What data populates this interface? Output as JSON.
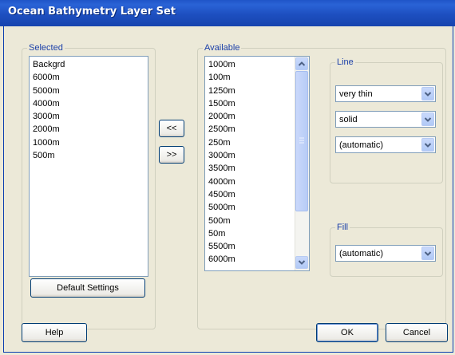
{
  "window": {
    "title": "Ocean Bathymetry Layer Set"
  },
  "selected": {
    "label": "Selected",
    "items": [
      "Backgrd",
      "6000m",
      "5000m",
      "4000m",
      "3000m",
      "2000m",
      "1000m",
      "500m"
    ]
  },
  "available": {
    "label": "Available",
    "items": [
      "1000m",
      "100m",
      "1250m",
      "1500m",
      "2000m",
      "2500m",
      "250m",
      "3000m",
      "3500m",
      "4000m",
      "4500m",
      "5000m",
      "500m",
      "50m",
      "5500m",
      "6000m"
    ]
  },
  "move": {
    "add_label": "<<",
    "remove_label": ">>"
  },
  "line": {
    "label": "Line",
    "width_value": "very thin",
    "style_value": "solid",
    "color_value": "(automatic)"
  },
  "fill": {
    "label": "Fill",
    "color_value": "(automatic)"
  },
  "buttons": {
    "default_settings": "Default Settings",
    "help": "Help",
    "ok": "OK",
    "cancel": "Cancel"
  },
  "icons": {
    "dropdown": "chevron-down-icon",
    "scroll_up": "chevron-up-icon",
    "scroll_down": "chevron-down-icon"
  }
}
